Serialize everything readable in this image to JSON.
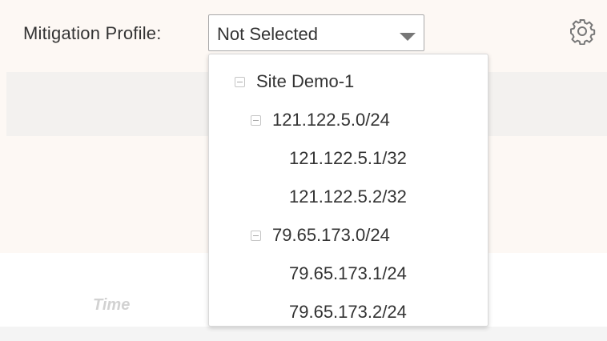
{
  "header": {
    "mitigation_label": "Mitigation Profile:",
    "select_value": "Not Selected",
    "settings_icon": "gear-icon"
  },
  "chart_area": {
    "time_label": "Time"
  },
  "dropdown": {
    "items": [
      {
        "label": "Site Demo-1",
        "level": 0,
        "collapsible": true
      },
      {
        "label": "121.122.5.0/24",
        "level": 1,
        "collapsible": true
      },
      {
        "label": "121.122.5.1/32",
        "level": 2,
        "collapsible": false
      },
      {
        "label": "121.122.5.2/32",
        "level": 2,
        "collapsible": false
      },
      {
        "label": "79.65.173.0/24",
        "level": 1,
        "collapsible": true
      },
      {
        "label": "79.65.173.1/24",
        "level": 2,
        "collapsible": false
      },
      {
        "label": "79.65.173.2/24",
        "level": 2,
        "collapsible": false
      }
    ]
  },
  "colors": {
    "text": "#333333",
    "border": "#a9a9a9",
    "muted": "#d2d2d2"
  }
}
